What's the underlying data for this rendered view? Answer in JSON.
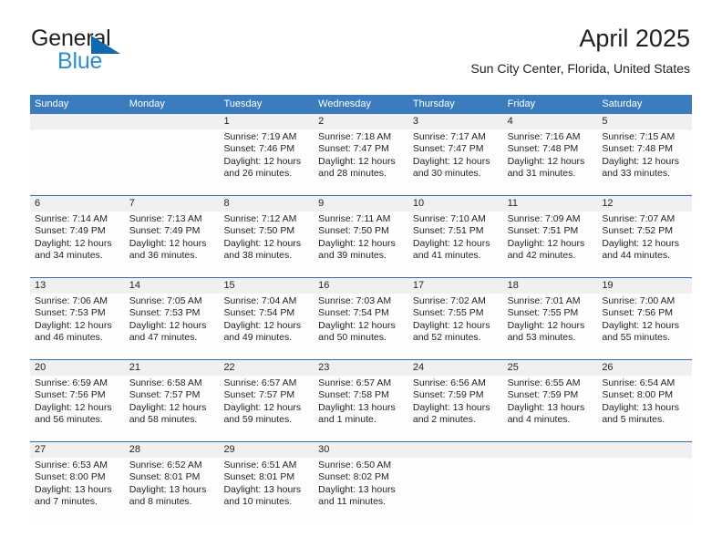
{
  "brand": {
    "name_part1": "General",
    "name_part2": "Blue",
    "triangle_icon": "triangle-icon",
    "color_dark": "#231f20",
    "color_blue": "#2a8fd4",
    "color_triangle": "#1268b3"
  },
  "header": {
    "title": "April 2025",
    "location": "Sun City Center, Florida, United States",
    "header_bg": "#3b7cbf",
    "band_bg": "#f0f0f0",
    "separator": "#2f6fae"
  },
  "weekdays": [
    "Sunday",
    "Monday",
    "Tuesday",
    "Wednesday",
    "Thursday",
    "Friday",
    "Saturday"
  ],
  "weeks": [
    [
      {
        "day": "",
        "lines": []
      },
      {
        "day": "",
        "lines": []
      },
      {
        "day": "1",
        "lines": [
          "Sunrise: 7:19 AM",
          "Sunset: 7:46 PM",
          "Daylight: 12 hours",
          "and 26 minutes."
        ]
      },
      {
        "day": "2",
        "lines": [
          "Sunrise: 7:18 AM",
          "Sunset: 7:47 PM",
          "Daylight: 12 hours",
          "and 28 minutes."
        ]
      },
      {
        "day": "3",
        "lines": [
          "Sunrise: 7:17 AM",
          "Sunset: 7:47 PM",
          "Daylight: 12 hours",
          "and 30 minutes."
        ]
      },
      {
        "day": "4",
        "lines": [
          "Sunrise: 7:16 AM",
          "Sunset: 7:48 PM",
          "Daylight: 12 hours",
          "and 31 minutes."
        ]
      },
      {
        "day": "5",
        "lines": [
          "Sunrise: 7:15 AM",
          "Sunset: 7:48 PM",
          "Daylight: 12 hours",
          "and 33 minutes."
        ]
      }
    ],
    [
      {
        "day": "6",
        "lines": [
          "Sunrise: 7:14 AM",
          "Sunset: 7:49 PM",
          "Daylight: 12 hours",
          "and 34 minutes."
        ]
      },
      {
        "day": "7",
        "lines": [
          "Sunrise: 7:13 AM",
          "Sunset: 7:49 PM",
          "Daylight: 12 hours",
          "and 36 minutes."
        ]
      },
      {
        "day": "8",
        "lines": [
          "Sunrise: 7:12 AM",
          "Sunset: 7:50 PM",
          "Daylight: 12 hours",
          "and 38 minutes."
        ]
      },
      {
        "day": "9",
        "lines": [
          "Sunrise: 7:11 AM",
          "Sunset: 7:50 PM",
          "Daylight: 12 hours",
          "and 39 minutes."
        ]
      },
      {
        "day": "10",
        "lines": [
          "Sunrise: 7:10 AM",
          "Sunset: 7:51 PM",
          "Daylight: 12 hours",
          "and 41 minutes."
        ]
      },
      {
        "day": "11",
        "lines": [
          "Sunrise: 7:09 AM",
          "Sunset: 7:51 PM",
          "Daylight: 12 hours",
          "and 42 minutes."
        ]
      },
      {
        "day": "12",
        "lines": [
          "Sunrise: 7:07 AM",
          "Sunset: 7:52 PM",
          "Daylight: 12 hours",
          "and 44 minutes."
        ]
      }
    ],
    [
      {
        "day": "13",
        "lines": [
          "Sunrise: 7:06 AM",
          "Sunset: 7:53 PM",
          "Daylight: 12 hours",
          "and 46 minutes."
        ]
      },
      {
        "day": "14",
        "lines": [
          "Sunrise: 7:05 AM",
          "Sunset: 7:53 PM",
          "Daylight: 12 hours",
          "and 47 minutes."
        ]
      },
      {
        "day": "15",
        "lines": [
          "Sunrise: 7:04 AM",
          "Sunset: 7:54 PM",
          "Daylight: 12 hours",
          "and 49 minutes."
        ]
      },
      {
        "day": "16",
        "lines": [
          "Sunrise: 7:03 AM",
          "Sunset: 7:54 PM",
          "Daylight: 12 hours",
          "and 50 minutes."
        ]
      },
      {
        "day": "17",
        "lines": [
          "Sunrise: 7:02 AM",
          "Sunset: 7:55 PM",
          "Daylight: 12 hours",
          "and 52 minutes."
        ]
      },
      {
        "day": "18",
        "lines": [
          "Sunrise: 7:01 AM",
          "Sunset: 7:55 PM",
          "Daylight: 12 hours",
          "and 53 minutes."
        ]
      },
      {
        "day": "19",
        "lines": [
          "Sunrise: 7:00 AM",
          "Sunset: 7:56 PM",
          "Daylight: 12 hours",
          "and 55 minutes."
        ]
      }
    ],
    [
      {
        "day": "20",
        "lines": [
          "Sunrise: 6:59 AM",
          "Sunset: 7:56 PM",
          "Daylight: 12 hours",
          "and 56 minutes."
        ]
      },
      {
        "day": "21",
        "lines": [
          "Sunrise: 6:58 AM",
          "Sunset: 7:57 PM",
          "Daylight: 12 hours",
          "and 58 minutes."
        ]
      },
      {
        "day": "22",
        "lines": [
          "Sunrise: 6:57 AM",
          "Sunset: 7:57 PM",
          "Daylight: 12 hours",
          "and 59 minutes."
        ]
      },
      {
        "day": "23",
        "lines": [
          "Sunrise: 6:57 AM",
          "Sunset: 7:58 PM",
          "Daylight: 13 hours",
          "and 1 minute."
        ]
      },
      {
        "day": "24",
        "lines": [
          "Sunrise: 6:56 AM",
          "Sunset: 7:59 PM",
          "Daylight: 13 hours",
          "and 2 minutes."
        ]
      },
      {
        "day": "25",
        "lines": [
          "Sunrise: 6:55 AM",
          "Sunset: 7:59 PM",
          "Daylight: 13 hours",
          "and 4 minutes."
        ]
      },
      {
        "day": "26",
        "lines": [
          "Sunrise: 6:54 AM",
          "Sunset: 8:00 PM",
          "Daylight: 13 hours",
          "and 5 minutes."
        ]
      }
    ],
    [
      {
        "day": "27",
        "lines": [
          "Sunrise: 6:53 AM",
          "Sunset: 8:00 PM",
          "Daylight: 13 hours",
          "and 7 minutes."
        ]
      },
      {
        "day": "28",
        "lines": [
          "Sunrise: 6:52 AM",
          "Sunset: 8:01 PM",
          "Daylight: 13 hours",
          "and 8 minutes."
        ]
      },
      {
        "day": "29",
        "lines": [
          "Sunrise: 6:51 AM",
          "Sunset: 8:01 PM",
          "Daylight: 13 hours",
          "and 10 minutes."
        ]
      },
      {
        "day": "30",
        "lines": [
          "Sunrise: 6:50 AM",
          "Sunset: 8:02 PM",
          "Daylight: 13 hours",
          "and 11 minutes."
        ]
      },
      {
        "day": "",
        "lines": []
      },
      {
        "day": "",
        "lines": []
      },
      {
        "day": "",
        "lines": []
      }
    ]
  ]
}
